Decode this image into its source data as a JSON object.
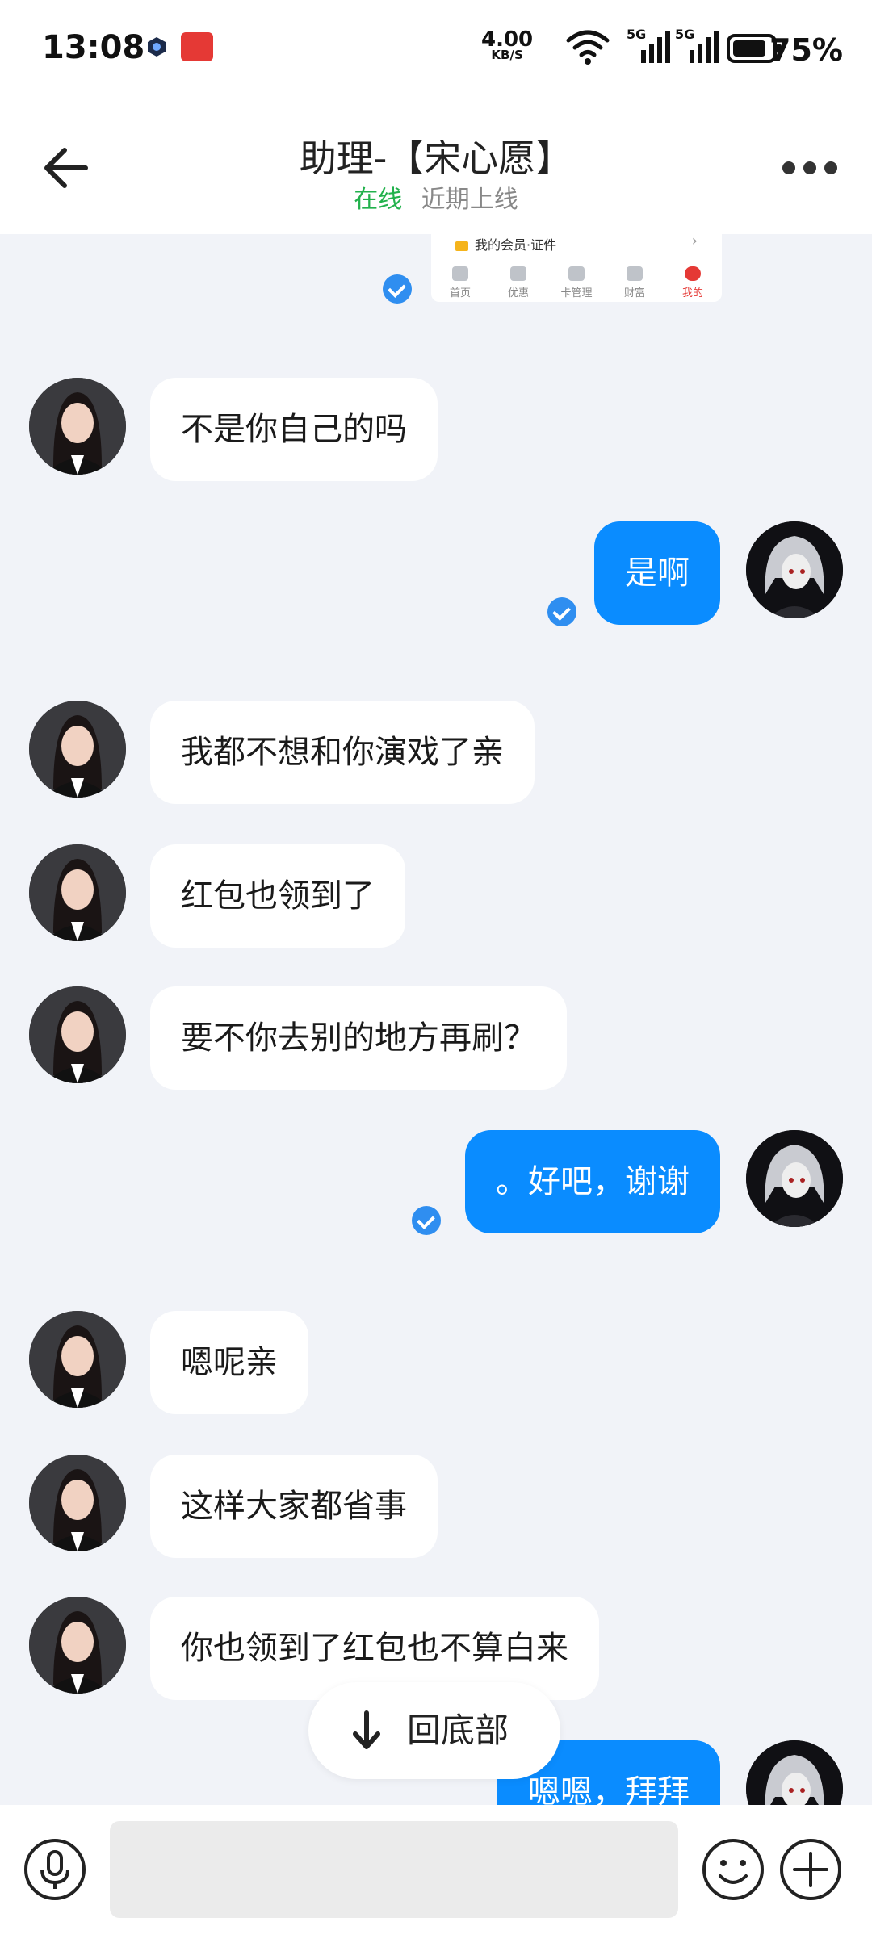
{
  "status_bar": {
    "time": "13:08",
    "net_speed": "4.00",
    "net_unit": "KB/S",
    "signal1": "5G",
    "signal2": "5G",
    "battery": "75%"
  },
  "header": {
    "title": "助理-【宋心愿】",
    "status_online": "在线",
    "status_recent": "近期上线"
  },
  "screenshot_card": {
    "row_label": "我的会员·证件",
    "tabs": [
      "首页",
      "优惠",
      "卡管理",
      "财富",
      "我的"
    ]
  },
  "messages": [
    {
      "side": "in",
      "text": "不是你自己的吗"
    },
    {
      "side": "out",
      "text": "是啊",
      "read": true
    },
    {
      "side": "in",
      "text": "我都不想和你演戏了亲"
    },
    {
      "side": "in",
      "text": "红包也领到了"
    },
    {
      "side": "in",
      "text": "要不你去别的地方再刷？"
    },
    {
      "side": "out",
      "text": "。好吧，谢谢",
      "read": true
    },
    {
      "side": "in",
      "text": "嗯呢亲"
    },
    {
      "side": "in",
      "text": "这样大家都省事"
    },
    {
      "side": "in",
      "text": "你也领到了红包也不算白来"
    },
    {
      "side": "out",
      "text": "嗯嗯，拜拜"
    }
  ],
  "jump_to_bottom": "回底部",
  "input": {
    "placeholder": ""
  },
  "colors": {
    "outgoing": "#0a8cff",
    "incoming": "#ffffff",
    "online": "#22b14c",
    "background": "#f1f3f8"
  }
}
